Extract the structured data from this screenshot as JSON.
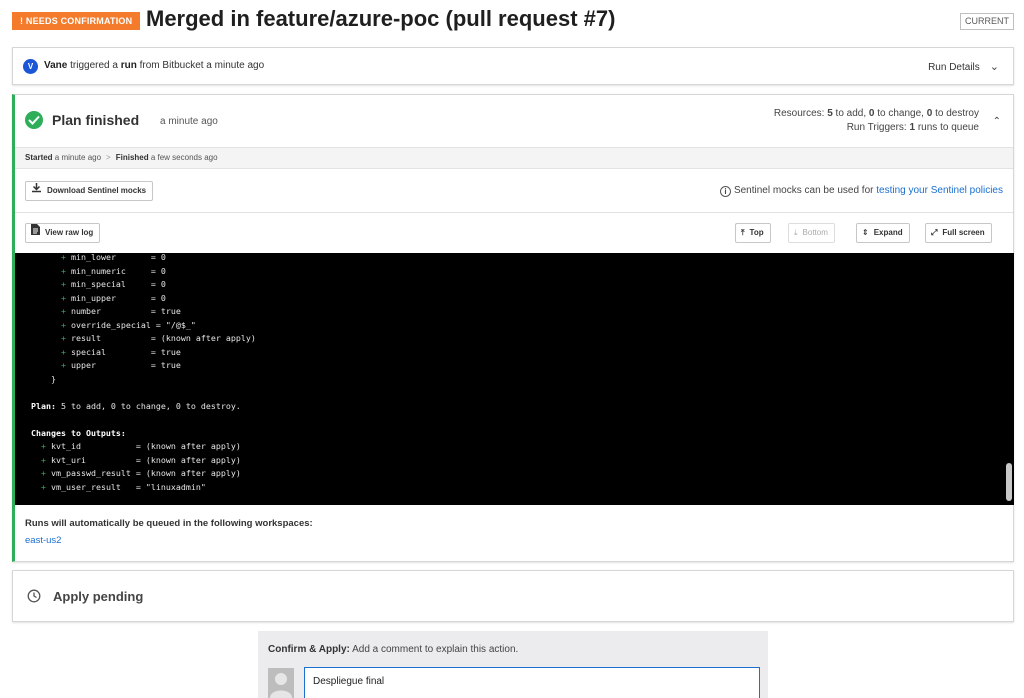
{
  "header": {
    "badge": "! NEEDS CONFIRMATION",
    "title": "Merged in feature/azure-poc (pull request #7)",
    "current_label": "CURRENT"
  },
  "run": {
    "avatar_initial": "V",
    "user": "Vane",
    "text1": " triggered a ",
    "run_word": "run",
    "text2": " from Bitbucket a minute ago",
    "details_label": "Run Details"
  },
  "plan": {
    "title": "Plan finished",
    "time": "a minute ago",
    "resources_prefix": "Resources: ",
    "add_count": "5",
    "add_text": " to add, ",
    "change_count": "0",
    "change_text": " to change, ",
    "destroy_count": "0",
    "destroy_text": " to destroy",
    "triggers_prefix": "Run Triggers: ",
    "triggers_count": "1",
    "triggers_text": " runs to queue",
    "started_label": "Started",
    "started_time": " a minute ago",
    "finished_label": "Finished",
    "finished_time": " a few seconds ago",
    "download_mocks_label": "Download Sentinel mocks",
    "mocks_info": "Sentinel mocks can be used for ",
    "mocks_link": "testing your Sentinel policies",
    "view_raw_log_label": "View raw log",
    "top_label": "Top",
    "bottom_label": "Bottom",
    "expand_label": "Expand",
    "fullscreen_label": "Full screen",
    "queued_text": "Runs will automatically be queued in the following workspaces:",
    "workspace": "east-us2"
  },
  "log": {
    "resource_lines": [
      {
        "key": "min_lower      ",
        "val": " = 0"
      },
      {
        "key": "min_numeric    ",
        "val": " = 0"
      },
      {
        "key": "min_special    ",
        "val": " = 0"
      },
      {
        "key": "min_upper      ",
        "val": " = 0"
      },
      {
        "key": "number         ",
        "val": " = true"
      },
      {
        "key": "override_special",
        "val": " = \"/@$_\""
      },
      {
        "key": "result         ",
        "val": " = (known after apply)"
      },
      {
        "key": "special        ",
        "val": " = true"
      },
      {
        "key": "upper          ",
        "val": " = true"
      }
    ],
    "closing_brace": "}",
    "plan_label": "Plan:",
    "plan_text": " 5 to add, 0 to change, 0 to destroy.",
    "outputs_label": "Changes to Outputs:",
    "output_lines": [
      {
        "key": "kvt_id          ",
        "val": " = (known after apply)"
      },
      {
        "key": "kvt_uri         ",
        "val": " = (known after apply)"
      },
      {
        "key": "vm_passwd_result",
        "val": " = (known after apply)"
      },
      {
        "key": "vm_user_result  ",
        "val": " = \"linuxadmin\""
      }
    ]
  },
  "apply": {
    "title": "Apply pending"
  },
  "confirm": {
    "label": "Confirm & Apply:",
    "hint": " Add a comment to explain this action.",
    "comment_value": "Despliegue final"
  },
  "colors": {
    "badge": "#f37b2b",
    "success": "#2fae5a",
    "link": "#1a6fd0",
    "avatar": "#1a56d6"
  }
}
